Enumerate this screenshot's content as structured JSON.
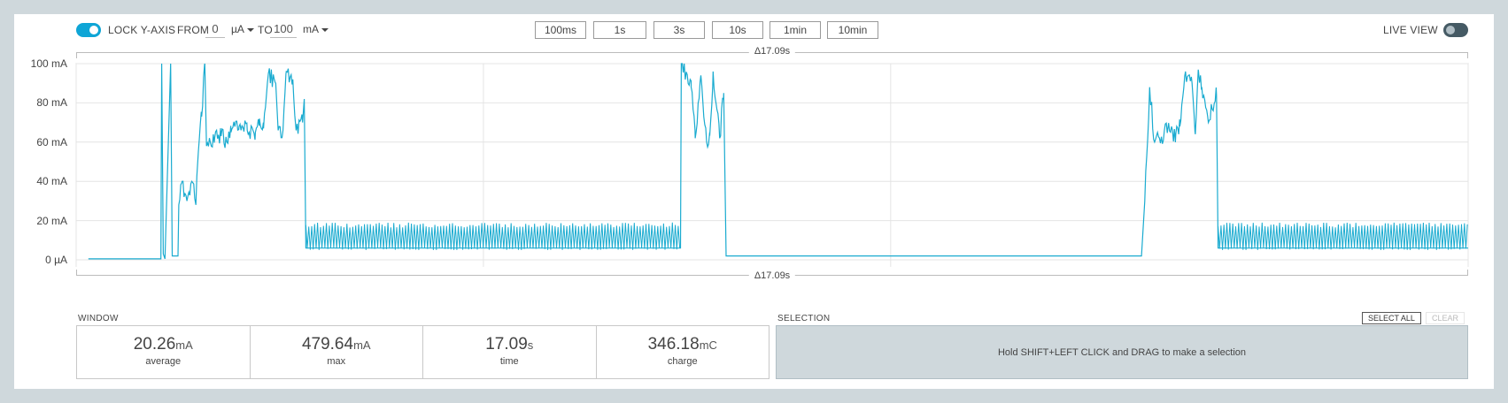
{
  "toolbar": {
    "lock_label": "LOCK Y-AXIS",
    "from_label": "FROM",
    "from_value": "0",
    "from_unit": "µA",
    "to_label": "TO",
    "to_value": "100",
    "to_unit": "mA",
    "ranges": [
      "100ms",
      "1s",
      "3s",
      "10s",
      "1min",
      "10min"
    ],
    "live_label": "LIVE VIEW",
    "lock_enabled": true,
    "live_enabled": false
  },
  "delta_label": "Δ17.09s",
  "window": {
    "label": "WINDOW",
    "stats": [
      {
        "value": "20.26",
        "unit": "mA",
        "label": "average"
      },
      {
        "value": "479.64",
        "unit": "mA",
        "label": "max"
      },
      {
        "value": "17.09",
        "unit": "s",
        "label": "time"
      },
      {
        "value": "346.18",
        "unit": "mC",
        "label": "charge"
      }
    ]
  },
  "selection": {
    "label": "SELECTION",
    "select_all": "SELECT ALL",
    "clear": "CLEAR",
    "hint": "Hold SHIFT+LEFT CLICK and DRAG to make a selection"
  },
  "colors": {
    "trace": "#1aabd0",
    "accent": "#0ea5d6",
    "grid": "#e4e4e4"
  },
  "chart_data": {
    "type": "line",
    "ylim": [
      0,
      100
    ],
    "xlim": [
      0,
      17.09
    ],
    "y_tick_labels": [
      "0 µA",
      "20 mA",
      "40 mA",
      "60 mA",
      "80 mA",
      "100 mA"
    ],
    "y_ticks": [
      0,
      20,
      40,
      60,
      80,
      100
    ],
    "x_gridlines": [
      0,
      5.0,
      10.0,
      17.09
    ],
    "series": [
      {
        "points": [
          [
            0.15,
            0.5
          ],
          [
            1.04,
            0.5
          ],
          [
            1.05,
            100
          ],
          [
            1.07,
            3
          ],
          [
            1.09,
            0.5
          ],
          [
            1.16,
            100
          ],
          [
            1.18,
            2
          ],
          [
            1.25,
            2
          ],
          [
            1.26,
            28
          ],
          [
            1.3,
            40
          ],
          [
            1.36,
            30
          ],
          [
            1.42,
            40
          ],
          [
            1.47,
            28
          ],
          [
            1.5,
            55
          ],
          [
            1.54,
            73
          ],
          [
            1.58,
            100
          ],
          [
            1.6,
            58
          ],
          [
            1.7,
            62
          ],
          [
            1.78,
            63
          ],
          [
            1.85,
            60
          ],
          [
            1.9,
            65
          ],
          [
            2.0,
            68
          ],
          [
            2.1,
            66
          ],
          [
            2.2,
            65
          ],
          [
            2.25,
            72
          ],
          [
            2.3,
            67
          ],
          [
            2.36,
            95
          ],
          [
            2.45,
            90
          ],
          [
            2.48,
            66
          ],
          [
            2.54,
            66
          ],
          [
            2.58,
            96
          ],
          [
            2.66,
            92
          ],
          [
            2.7,
            66
          ],
          [
            2.78,
            70
          ],
          [
            2.8,
            82
          ],
          [
            2.82,
            6
          ],
          [
            7.42,
            6
          ],
          [
            7.43,
            100
          ],
          [
            7.55,
            88
          ],
          [
            7.6,
            62
          ],
          [
            7.67,
            94
          ],
          [
            7.74,
            60
          ],
          [
            7.78,
            64
          ],
          [
            7.82,
            96
          ],
          [
            7.9,
            62
          ],
          [
            7.95,
            85
          ],
          [
            7.98,
            2
          ],
          [
            13.08,
            2
          ],
          [
            13.12,
            30
          ],
          [
            13.18,
            88
          ],
          [
            13.24,
            60
          ],
          [
            13.3,
            62
          ],
          [
            13.4,
            66
          ],
          [
            13.5,
            64
          ],
          [
            13.55,
            68
          ],
          [
            13.62,
            96
          ],
          [
            13.7,
            90
          ],
          [
            13.74,
            64
          ],
          [
            13.78,
            96
          ],
          [
            13.82,
            88
          ],
          [
            13.9,
            70
          ],
          [
            14.0,
            84
          ],
          [
            14.02,
            6
          ],
          [
            17.09,
            6
          ]
        ]
      }
    ],
    "noise_bands": [
      {
        "from": 2.82,
        "to": 7.42,
        "low": 5,
        "high": 19
      },
      {
        "from": 14.02,
        "to": 17.09,
        "low": 5,
        "high": 19
      }
    ]
  }
}
